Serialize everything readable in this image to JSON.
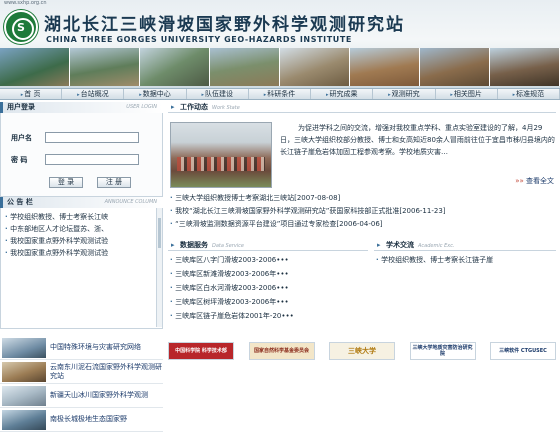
{
  "header": {
    "url_text": "www.sxhp.org.cn",
    "logo_glyph": "S",
    "title": "湖北长江三峡滑坡国家野外科学观测研究站",
    "subtitle": "CHINA THREE GORGES UNIVERSITY GEO-HAZARDS INSTITUTE"
  },
  "nav": {
    "items": [
      "首 页",
      "台站概况",
      "数据中心",
      "队伍建设",
      "科研条件",
      "研究成果",
      "观测研究",
      "相关图片",
      "标准规范"
    ]
  },
  "login": {
    "title": "用户登录",
    "title_en": "USER LOGIN",
    "username_label": "用户名",
    "password_label": "密 码",
    "username_value": "",
    "password_value": "",
    "login_button": "登 录",
    "register_button": "注 册"
  },
  "notice": {
    "title": "公 告 栏",
    "title_en": "ANNOUNCE COLUMN",
    "items": [
      "学校组织教授、博士考察长江峡",
      "中东部地区人才论坛暨苏、浙、",
      "我校国家重点野外科学观测试验",
      "我校国家重点野外科学观测试验"
    ]
  },
  "links": {
    "items": [
      "中国特殊环境与灾害研究网络",
      "云南东川泥石流国家野外科学观测研究站",
      "新疆天山冰川国家野外科学观测",
      "南极长城极地生态国家野"
    ]
  },
  "work_state": {
    "title": "工作动态",
    "title_en": "Work State",
    "description": "为促进学科之间的交流，增强对我校重点学科、重点实验室建设的了解，4月29日，三峡大学组织校部分教授、博士和女高知近80余人冒雨前往位于宜昌市秭归县境内的长江链子崖危岩体加固工程参观考察。学校地质灾害…",
    "see_all": "查看全文",
    "news": [
      "三峡大学组织教授博士考察湖北三峡站[2007-08-08]",
      "我校“湖北长江三峡滑坡国家野外科学观测研究站”获国家科技部正式批准[2006-11-23]",
      "“三峡滑坡监测数据资源平台建设”项目通过专家检查[2006-04-06]"
    ]
  },
  "data_service": {
    "title": "数据服务",
    "title_en": "Data Service",
    "items": [
      "三峡库区八字门滑坡2003-2006•••",
      "三峡库区新滩滑坡2003-2006年•••",
      "三峡库区白水河滑坡2003-2006•••",
      "三峡库区树坪滑坡2003-2006年•••",
      "三峡库区链子崖危岩体2001年-20•••"
    ]
  },
  "academic": {
    "title": "学术交流",
    "title_en": "Academic Exc.",
    "items": [
      "学校组织教授、博士考察长江链子崖"
    ]
  },
  "partner_logos": [
    "中国科学院 科学技术部",
    "国家自然科学基金委员会",
    "三峡大学",
    "三峡大学地质灾害防治研究院",
    "三峡软件 CTGUSEC"
  ]
}
